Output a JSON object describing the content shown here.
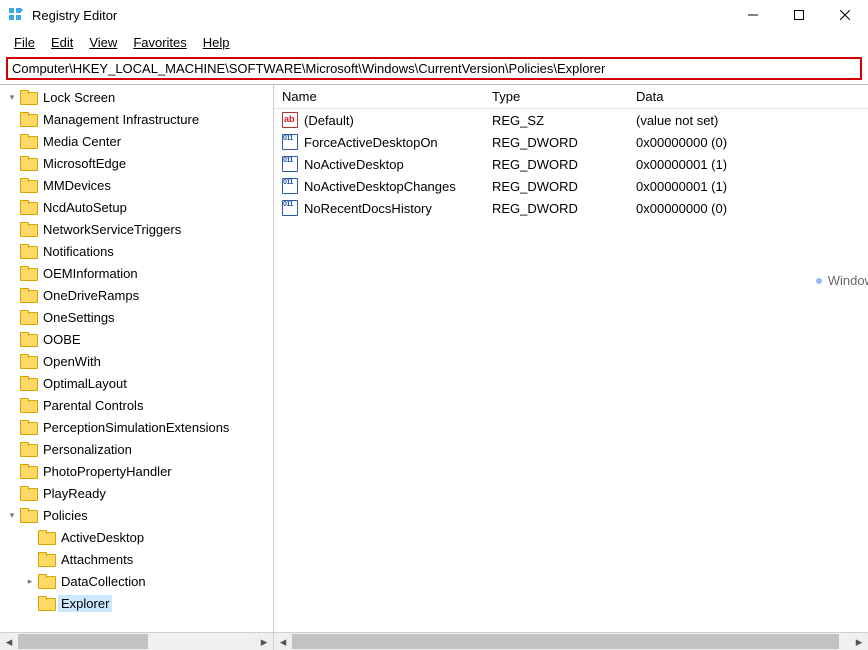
{
  "window": {
    "title": "Registry Editor"
  },
  "menu": {
    "file": "File",
    "edit": "Edit",
    "view": "View",
    "favorites": "Favorites",
    "help": "Help"
  },
  "address": {
    "path": "Computer\\HKEY_LOCAL_MACHINE\\SOFTWARE\\Microsoft\\Windows\\CurrentVersion\\Policies\\Explorer"
  },
  "tree": {
    "items": [
      {
        "label": "Lock Screen",
        "depth": 1,
        "exp": "▾"
      },
      {
        "label": "Management Infrastructure",
        "depth": 1,
        "exp": ""
      },
      {
        "label": "Media Center",
        "depth": 1,
        "exp": ""
      },
      {
        "label": "MicrosoftEdge",
        "depth": 1,
        "exp": ""
      },
      {
        "label": "MMDevices",
        "depth": 1,
        "exp": ""
      },
      {
        "label": "NcdAutoSetup",
        "depth": 1,
        "exp": ""
      },
      {
        "label": "NetworkServiceTriggers",
        "depth": 1,
        "exp": ""
      },
      {
        "label": "Notifications",
        "depth": 1,
        "exp": ""
      },
      {
        "label": "OEMInformation",
        "depth": 1,
        "exp": ""
      },
      {
        "label": "OneDriveRamps",
        "depth": 1,
        "exp": ""
      },
      {
        "label": "OneSettings",
        "depth": 1,
        "exp": ""
      },
      {
        "label": "OOBE",
        "depth": 1,
        "exp": ""
      },
      {
        "label": "OpenWith",
        "depth": 1,
        "exp": ""
      },
      {
        "label": "OptimalLayout",
        "depth": 1,
        "exp": ""
      },
      {
        "label": "Parental Controls",
        "depth": 1,
        "exp": ""
      },
      {
        "label": "PerceptionSimulationExtensions",
        "depth": 1,
        "exp": ""
      },
      {
        "label": "Personalization",
        "depth": 1,
        "exp": ""
      },
      {
        "label": "PhotoPropertyHandler",
        "depth": 1,
        "exp": ""
      },
      {
        "label": "PlayReady",
        "depth": 1,
        "exp": ""
      },
      {
        "label": "Policies",
        "depth": 1,
        "exp": "▾"
      },
      {
        "label": "ActiveDesktop",
        "depth": 2,
        "exp": ""
      },
      {
        "label": "Attachments",
        "depth": 2,
        "exp": ""
      },
      {
        "label": "DataCollection",
        "depth": 2,
        "exp": "▸"
      },
      {
        "label": "Explorer",
        "depth": 2,
        "exp": "",
        "sel": true
      }
    ]
  },
  "list": {
    "headers": {
      "name": "Name",
      "type": "Type",
      "data": "Data"
    },
    "rows": [
      {
        "icon": "sz",
        "name": "(Default)",
        "type": "REG_SZ",
        "data": "(value not set)"
      },
      {
        "icon": "dw",
        "name": "ForceActiveDesktopOn",
        "type": "REG_DWORD",
        "data": "0x00000000 (0)"
      },
      {
        "icon": "dw",
        "name": "NoActiveDesktop",
        "type": "REG_DWORD",
        "data": "0x00000001 (1)"
      },
      {
        "icon": "dw",
        "name": "NoActiveDesktopChanges",
        "type": "REG_DWORD",
        "data": "0x00000001 (1)"
      },
      {
        "icon": "dw",
        "name": "NoRecentDocsHistory",
        "type": "REG_DWORD",
        "data": "0x00000000 (0)"
      }
    ]
  },
  "watermark": {
    "text": "Window"
  }
}
